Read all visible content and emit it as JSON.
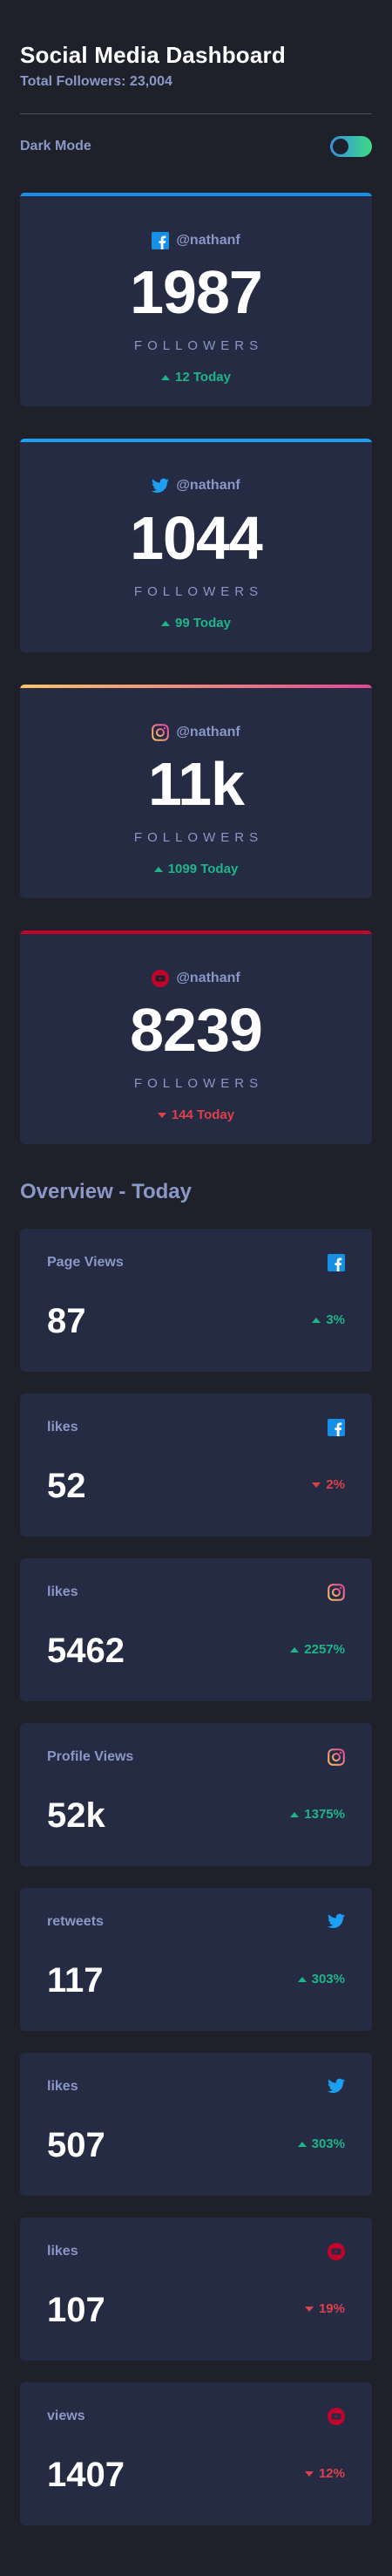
{
  "header": {
    "title": "Social Media Dashboard",
    "subtitle": "Total Followers: 23,004",
    "dark_mode_label": "Dark Mode",
    "dark_mode_on": true
  },
  "colors": {
    "background": "#1e202a",
    "card": "#252b43",
    "text_muted": "#8b97c6",
    "up": "#1eb589",
    "down": "#dc414c",
    "facebook": "#178fe6",
    "twitter": "#1ca0f2",
    "instagram_gradient": [
      "#fdc468",
      "#df4996"
    ],
    "youtube": "#c4032b"
  },
  "follower_cards": [
    {
      "network": "facebook",
      "icon": "facebook-icon",
      "handle": "@nathanf",
      "count": "1987",
      "count_label": "FOLLOWERS",
      "today": "12 Today",
      "trend": "up"
    },
    {
      "network": "twitter",
      "icon": "twitter-icon",
      "handle": "@nathanf",
      "count": "1044",
      "count_label": "FOLLOWERS",
      "today": "99 Today",
      "trend": "up"
    },
    {
      "network": "instagram",
      "icon": "instagram-icon",
      "handle": "@nathanf",
      "count": "11k",
      "count_label": "FOLLOWERS",
      "today": "1099 Today",
      "trend": "up"
    },
    {
      "network": "youtube",
      "icon": "youtube-icon",
      "handle": "@nathanf",
      "count": "8239",
      "count_label": "FOLLOWERS",
      "today": "144 Today",
      "trend": "down"
    }
  ],
  "overview": {
    "title": "Overview - Today",
    "items": [
      {
        "label": "Page Views",
        "network": "facebook",
        "icon": "facebook-icon",
        "value": "87",
        "change": "3%",
        "trend": "up"
      },
      {
        "label": "likes",
        "network": "facebook",
        "icon": "facebook-icon",
        "value": "52",
        "change": "2%",
        "trend": "down"
      },
      {
        "label": "likes",
        "network": "instagram",
        "icon": "instagram-icon",
        "value": "5462",
        "change": "2257%",
        "trend": "up"
      },
      {
        "label": "Profile Views",
        "network": "instagram",
        "icon": "instagram-icon",
        "value": "52k",
        "change": "1375%",
        "trend": "up"
      },
      {
        "label": "retweets",
        "network": "twitter",
        "icon": "twitter-icon",
        "value": "117",
        "change": "303%",
        "trend": "up"
      },
      {
        "label": "likes",
        "network": "twitter",
        "icon": "twitter-icon",
        "value": "507",
        "change": "303%",
        "trend": "up"
      },
      {
        "label": "likes",
        "network": "youtube",
        "icon": "youtube-icon",
        "value": "107",
        "change": "19%",
        "trend": "down"
      },
      {
        "label": "views",
        "network": "youtube",
        "icon": "youtube-icon",
        "value": "1407",
        "change": "12%",
        "trend": "down"
      }
    ]
  }
}
